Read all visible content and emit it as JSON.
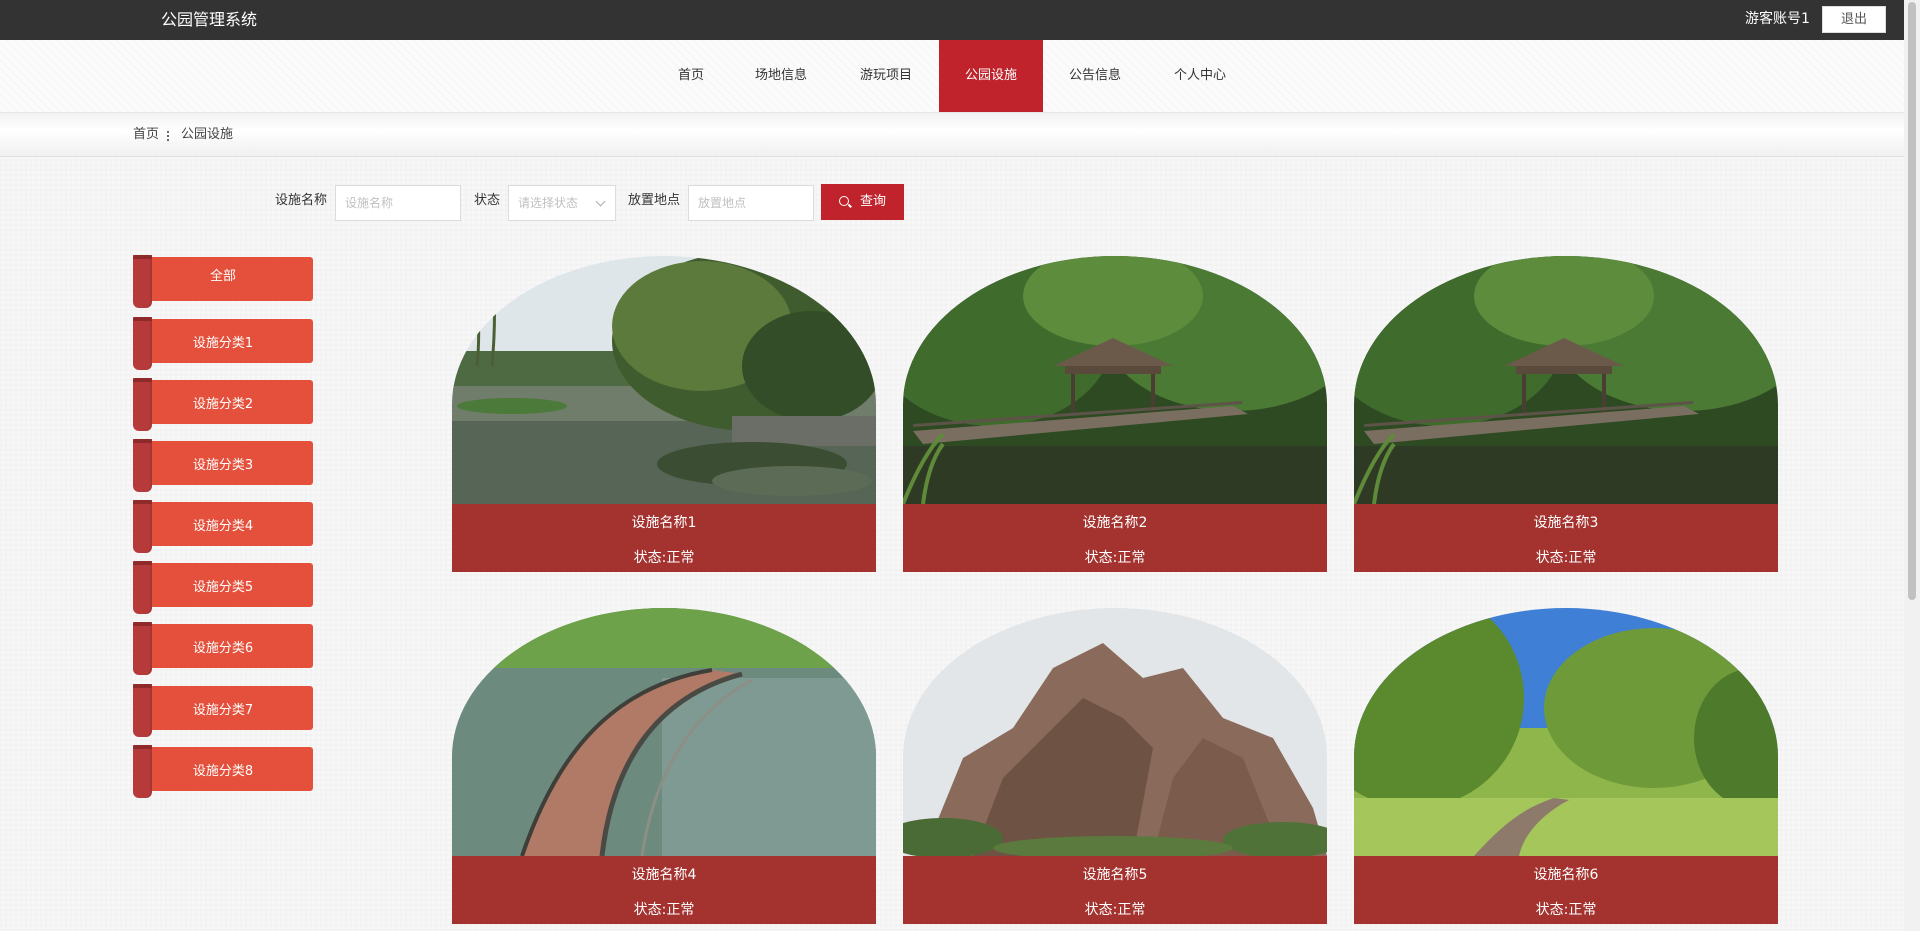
{
  "header": {
    "app_title": "公园管理系统",
    "user_label": "游客账号1",
    "logout_label": "退出"
  },
  "nav": {
    "items": [
      {
        "label": "首页"
      },
      {
        "label": "场地信息"
      },
      {
        "label": "游玩项目"
      },
      {
        "label": "公园设施"
      },
      {
        "label": "公告信息"
      },
      {
        "label": "个人中心"
      }
    ],
    "active_index": 3
  },
  "breadcrumb": {
    "home": "首页",
    "current": "公园设施"
  },
  "search": {
    "name_label": "设施名称",
    "name_placeholder": "设施名称",
    "status_label": "状态",
    "status_placeholder": "请选择状态",
    "location_label": "放置地点",
    "location_placeholder": "放置地点",
    "query_label": "查询"
  },
  "categories": [
    {
      "label": "全部"
    },
    {
      "label": "设施分类1"
    },
    {
      "label": "设施分类2"
    },
    {
      "label": "设施分类3"
    },
    {
      "label": "设施分类4"
    },
    {
      "label": "设施分类5"
    },
    {
      "label": "设施分类6"
    },
    {
      "label": "设施分类7"
    },
    {
      "label": "设施分类8"
    }
  ],
  "facilities": [
    {
      "name": "设施名称1",
      "status": "状态:正常",
      "image": "willow-lake-photo"
    },
    {
      "name": "设施名称2",
      "status": "状态:正常",
      "image": "pavilion-boardwalk-photo"
    },
    {
      "name": "设施名称3",
      "status": "状态:正常",
      "image": "pavilion-boardwalk-photo"
    },
    {
      "name": "设施名称4",
      "status": "状态:正常",
      "image": "lake-walkway-photo"
    },
    {
      "name": "设施名称5",
      "status": "状态:正常",
      "image": "rockery-photo"
    },
    {
      "name": "设施名称6",
      "status": "状态:正常",
      "image": "forest-path-photo"
    }
  ],
  "colors": {
    "topbar": "#333333",
    "accent_red": "#c0232c",
    "category_red": "#e4503b",
    "card_info_red": "#a43330"
  }
}
